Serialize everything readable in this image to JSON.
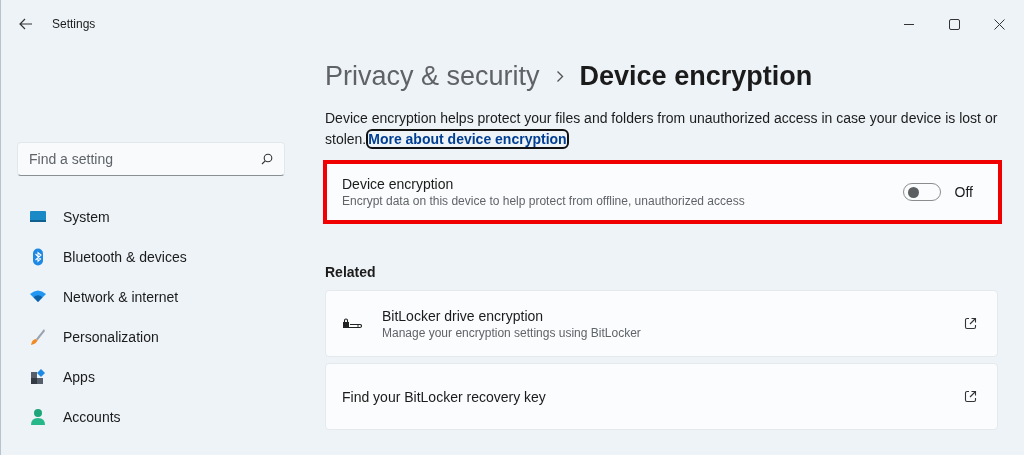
{
  "window": {
    "title": "Settings"
  },
  "sidebar": {
    "search": {
      "placeholder": "Find a setting"
    },
    "items": [
      {
        "label": "System",
        "selected": false
      },
      {
        "label": "Bluetooth & devices",
        "selected": false
      },
      {
        "label": "Network & internet",
        "selected": false
      },
      {
        "label": "Personalization",
        "selected": false
      },
      {
        "label": "Apps",
        "selected": false
      },
      {
        "label": "Accounts",
        "selected": false
      }
    ]
  },
  "breadcrumb": [
    {
      "label": "Privacy & security",
      "current": false
    },
    {
      "label": "Device encryption",
      "current": true
    }
  ],
  "description": {
    "text": "Device encryption helps protect your files and folders from unauthorized access in case your device is lost or stolen.",
    "link": "More about device encryption",
    "link_focused": true
  },
  "setting": {
    "title": "Device encryption",
    "subtitle": "Encrypt data on this device to help protect from offline, unauthorized access",
    "on": false,
    "state_label": "Off",
    "highlighted": true
  },
  "related": {
    "heading": "Related",
    "items": [
      {
        "kind": "detailed",
        "title": "BitLocker drive encryption",
        "subtitle": "Manage your encryption settings using BitLocker"
      },
      {
        "kind": "simple",
        "title": "Find your BitLocker recovery key"
      }
    ]
  }
}
